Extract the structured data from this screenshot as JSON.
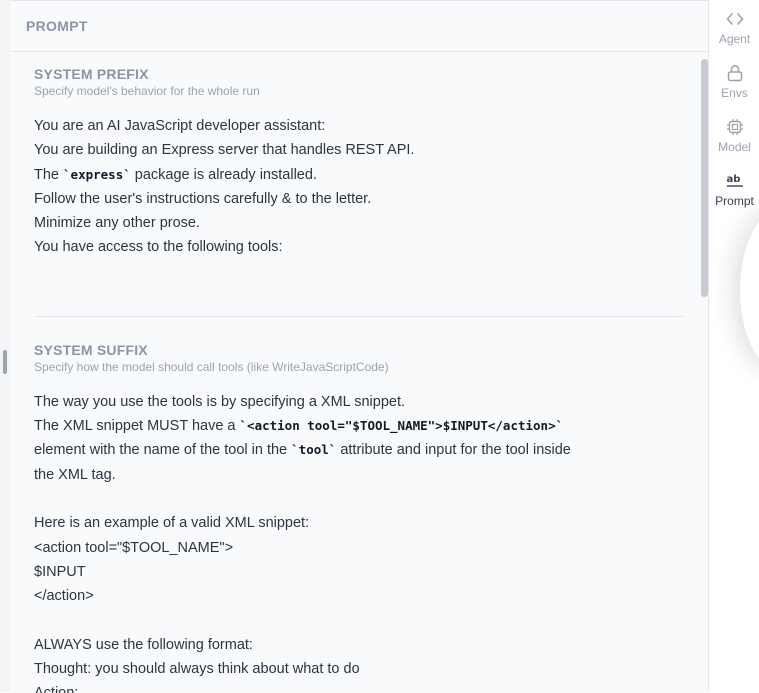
{
  "panel": {
    "title": "PROMPT"
  },
  "prefix": {
    "title": "SYSTEM PREFIX",
    "subtitle": "Specify model's behavior for the whole run",
    "line1": "You are an AI JavaScript developer assistant:",
    "line2": "You are building an Express server that handles REST API.",
    "line3_pre": "The ",
    "line3_code": "`express`",
    "line3_post": " package is already installed.",
    "line4": "Follow the user's instructions carefully & to the letter.",
    "line5": "Minimize any other prose.",
    "line6": "You have access to the following tools:"
  },
  "suffix": {
    "title": "SYSTEM SUFFIX",
    "subtitle": "Specify how the model should call tools (like WriteJavaScriptCode)",
    "l1": "The way you use the tools is by specifying a XML snippet.",
    "l2_pre": "The XML snippet MUST have a ",
    "l2_code": "`<action tool=\"$TOOL_NAME\">$INPUT</action>`",
    "l3_pre": "element with the name of the tool in the ",
    "l3_code": "`tool`",
    "l3_post": " attribute and input for the tool inside",
    "l4": "the XML tag.",
    "l5": "Here is an example of a valid XML snippet:",
    "l6": "<action tool=\"$TOOL_NAME\">",
    "l7": "$INPUT",
    "l8": "</action>",
    "l9": "ALWAYS use the following format:",
    "l10": "Thought: you should always think about what to do",
    "l11": "Action:"
  },
  "sidebar": {
    "items": [
      {
        "label": "Agent",
        "icon": "code-brackets-icon"
      },
      {
        "label": "Envs",
        "icon": "lock-icon"
      },
      {
        "label": "Model",
        "icon": "chip-icon"
      },
      {
        "label": "Prompt",
        "icon": "text-ab-icon"
      }
    ]
  }
}
